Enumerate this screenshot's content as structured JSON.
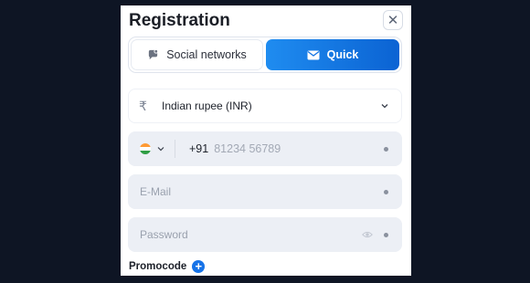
{
  "title": "Registration",
  "close_icon": "close-icon",
  "tabs": [
    {
      "label": "Social networks",
      "icon": "chat-bubble-icon",
      "active": false
    },
    {
      "label": "Quick",
      "icon": "envelope-icon",
      "active": true
    }
  ],
  "currency": {
    "icon": "rupee-icon",
    "value": "Indian rupee (INR)"
  },
  "phone": {
    "country_flag": "india-flag-icon",
    "code": "+91",
    "placeholder": "81234 56789"
  },
  "email": {
    "placeholder": "E-Mail"
  },
  "password": {
    "placeholder": "Password",
    "toggle_icon": "eye-icon"
  },
  "promo": {
    "label": "Promocode",
    "icon": "plus-icon"
  },
  "colors": {
    "accent": "#1673e8",
    "background": "#0e1524",
    "field": "#eceff5"
  }
}
